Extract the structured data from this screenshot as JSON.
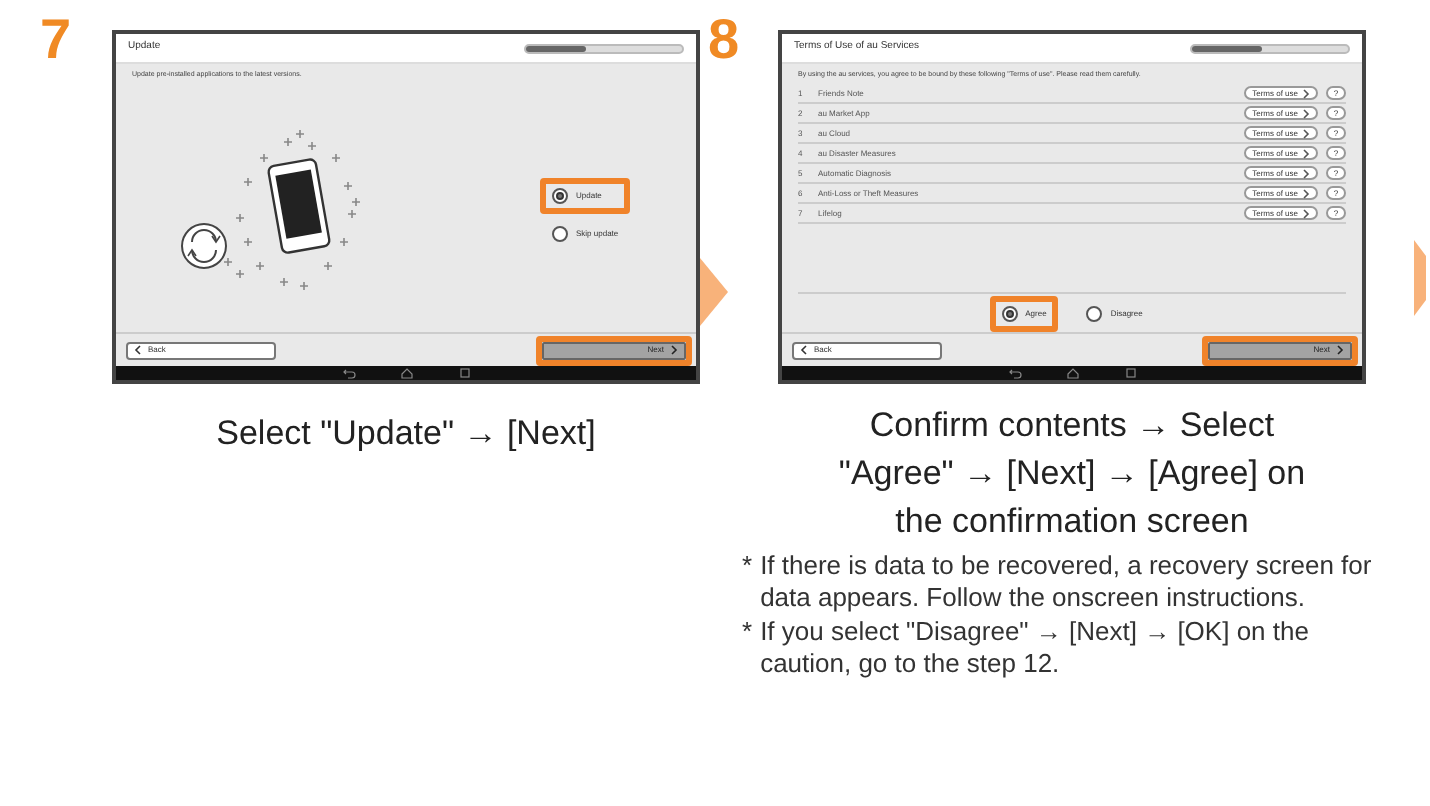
{
  "step_7": {
    "number": "7",
    "screen": {
      "kind": "update",
      "title": "Update",
      "progress": {
        "level": 0.38
      },
      "description": "Update pre-installed applications to the latest versions.",
      "options": [
        {
          "label": "Update",
          "selected": true,
          "highlighted": true
        },
        {
          "label": "Skip update",
          "selected": false,
          "highlighted": false
        }
      ],
      "back_button": "Back",
      "next_button": {
        "label": "Next",
        "highlighted": true
      }
    },
    "caption": [
      "Select \"Update\" → [Next]"
    ]
  },
  "step_8": {
    "number": "8",
    "screen": {
      "kind": "terms",
      "title": "Terms of Use of au Services",
      "progress": {
        "level": 0.45
      },
      "description": "By using the au services, you agree to be bound by these following \"Terms of use\". Please read them carefully.",
      "services": [
        {
          "index": "1",
          "name": "Friends Note",
          "terms_button": "Terms of use",
          "help_button": "?"
        },
        {
          "index": "2",
          "name": "au Market App",
          "terms_button": "Terms of use",
          "help_button": "?"
        },
        {
          "index": "3",
          "name": "au Cloud",
          "terms_button": "Terms of use",
          "help_button": "?"
        },
        {
          "index": "4",
          "name": "au Disaster Measures",
          "terms_button": "Terms of use",
          "help_button": "?"
        },
        {
          "index": "5",
          "name": "Automatic Diagnosis",
          "terms_button": "Terms of use",
          "help_button": "?"
        },
        {
          "index": "6",
          "name": "Anti-Loss or Theft Measures",
          "terms_button": "Terms of use",
          "help_button": "?"
        },
        {
          "index": "7",
          "name": "Lifelog",
          "terms_button": "Terms of use",
          "help_button": "?"
        }
      ],
      "options": [
        {
          "label": "Agree",
          "selected": true,
          "highlighted": true
        },
        {
          "label": "Disagree",
          "selected": false,
          "highlighted": false
        }
      ],
      "back_button": "Back",
      "next_button": {
        "label": "Next",
        "highlighted": true
      }
    },
    "caption": [
      "Confirm contents → Select",
      "\"Agree\" → [Next] → [Agree] on",
      "the confirmation screen"
    ],
    "notes": [
      {
        "mark": "*",
        "text": "If there is data to be recovered, a recovery screen for data appears. Follow the onscreen instructions."
      },
      {
        "mark": "*",
        "text": "If you select \"Disagree\" → [Next] → [OK] on the caution, go to  the step 12."
      }
    ]
  }
}
